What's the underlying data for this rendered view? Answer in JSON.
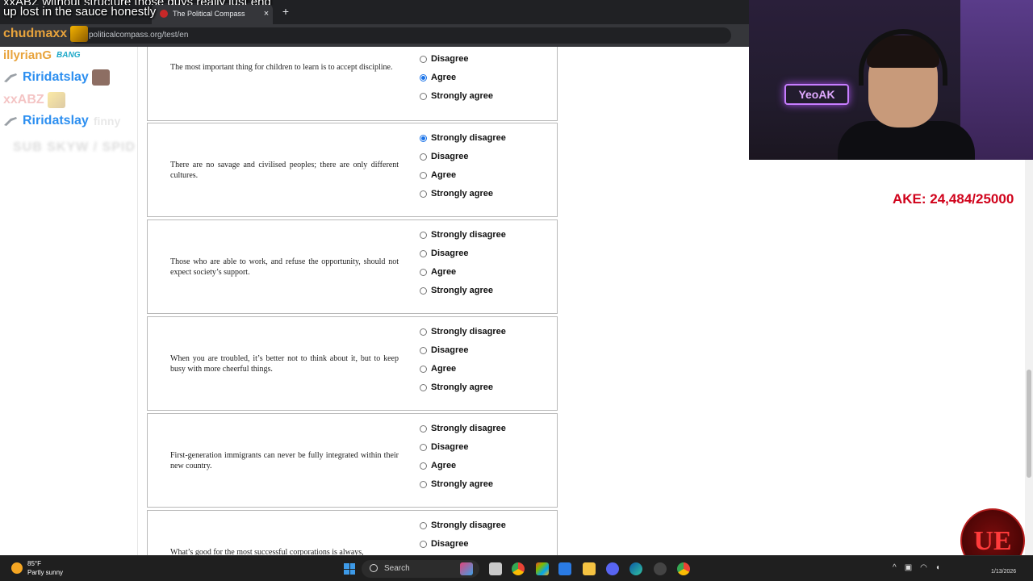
{
  "browser": {
    "tab_title": "The Political Compass",
    "tab_close": "×",
    "new_tab": "+",
    "url": "politicalcompass.org/test/en"
  },
  "overlay": {
    "caption_line1": "xxABZ without structure those guys really just end",
    "caption_line2": "up lost in the sauce honestly",
    "chat": [
      {
        "user": "chudmaxx",
        "color": "#e8a33c"
      },
      {
        "user": "illyrianG",
        "color": "#e8a33c",
        "emote_text": "BANG"
      },
      {
        "user": "Riridatslay",
        "color": "#2d8ff0"
      },
      {
        "user": "xxABZ",
        "color": "#e9a0a0"
      },
      {
        "user": "Riridatslay",
        "color": "#2d8ff0",
        "trailing": "finny"
      }
    ],
    "blurred": "SUB SKYW / SPID",
    "sub_goal": "AKE: 24,484/25000",
    "cam_sign": "YeoAK"
  },
  "questions": [
    {
      "text": "The most important thing for children to learn is to accept discipline.",
      "options": [
        "Disagree",
        "Agree",
        "Strongly agree"
      ],
      "selected": "Agree"
    },
    {
      "text": "There are no savage and civilised peoples; there are only different cultures.",
      "options": [
        "Strongly disagree",
        "Disagree",
        "Agree",
        "Strongly agree"
      ],
      "selected": "Strongly disagree"
    },
    {
      "text": "Those who are able to work, and refuse the opportunity, should not expect society’s support.",
      "options": [
        "Strongly disagree",
        "Disagree",
        "Agree",
        "Strongly agree"
      ],
      "selected": null
    },
    {
      "text": "When you are troubled, it’s better not to think about it, but to keep busy with more cheerful things.",
      "options": [
        "Strongly disagree",
        "Disagree",
        "Agree",
        "Strongly agree"
      ],
      "selected": null
    },
    {
      "text": "First-generation immigrants can never be fully integrated within their new country.",
      "options": [
        "Strongly disagree",
        "Disagree",
        "Agree",
        "Strongly agree"
      ],
      "selected": null
    },
    {
      "text": "What’s good for the most successful corporations is always,",
      "options": [
        "Strongly disagree",
        "Disagree"
      ],
      "selected": null
    }
  ],
  "taskbar": {
    "temp": "85°F",
    "weather": "Partly sunny",
    "search_label": "Search",
    "date": "1/13/2026",
    "logo_text": "UE"
  },
  "colors": {
    "radio_accent": "#1a73e8",
    "sub_goal": "#d0021b"
  }
}
